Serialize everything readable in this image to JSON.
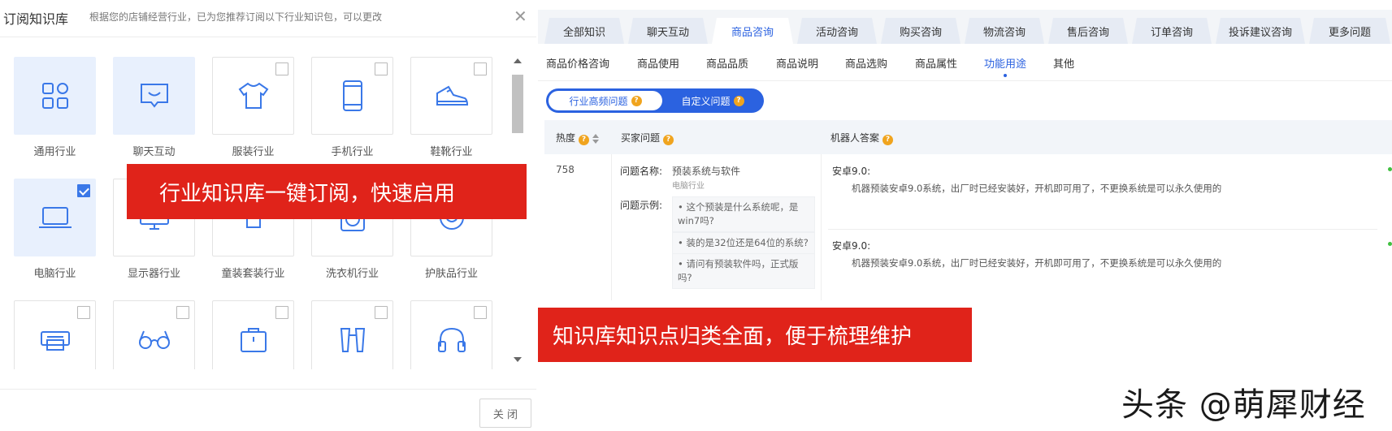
{
  "dialog": {
    "title": "订阅知识库",
    "subtitle": "根据您的店铺经营行业，已为您推荐订阅以下行业知识包，可以更改",
    "close_symbol": "✕",
    "close_button": "关 闭",
    "tiles": [
      {
        "label": "通用行业",
        "icon": "apps-grid-icon",
        "selected": true,
        "checkbox": false
      },
      {
        "label": "聊天互动",
        "icon": "chat-bubble-icon",
        "selected": true,
        "checkbox": false
      },
      {
        "label": "服装行业",
        "icon": "tshirt-icon",
        "selected": false,
        "checkbox": true,
        "checked": false
      },
      {
        "label": "手机行业",
        "icon": "smartphone-icon",
        "selected": false,
        "checkbox": true,
        "checked": false
      },
      {
        "label": "鞋靴行业",
        "icon": "sneaker-icon",
        "selected": false,
        "checkbox": true,
        "checked": false
      },
      {
        "label": "电脑行业",
        "icon": "laptop-icon",
        "selected": true,
        "checkbox": true,
        "checked": true
      },
      {
        "label": "显示器行业",
        "icon": "monitor-icon",
        "selected": false,
        "checkbox": false
      },
      {
        "label": "童装套装行业",
        "icon": "baby-clothes-icon",
        "selected": false,
        "checkbox": false
      },
      {
        "label": "洗衣机行业",
        "icon": "washing-machine-icon",
        "selected": false,
        "checkbox": false
      },
      {
        "label": "护肤品行业",
        "icon": "skincare-icon",
        "selected": false,
        "checkbox": false
      },
      {
        "label": "",
        "icon": "printer-icon",
        "selected": false,
        "checkbox": true,
        "checked": false
      },
      {
        "label": "",
        "icon": "glasses-icon",
        "selected": false,
        "checkbox": true,
        "checked": false
      },
      {
        "label": "",
        "icon": "bag-icon",
        "selected": false,
        "checkbox": true,
        "checked": false
      },
      {
        "label": "",
        "icon": "binoculars-icon",
        "selected": false,
        "checkbox": true,
        "checked": false
      },
      {
        "label": "",
        "icon": "headphones-icon",
        "selected": false,
        "checkbox": true,
        "checked": false
      }
    ]
  },
  "banners": {
    "one": "行业知识库一键订阅，快速启用",
    "two": "知识库知识点归类全面，便于梳理维护"
  },
  "panel": {
    "tabs": [
      "全部知识",
      "聊天互动",
      "商品咨询",
      "活动咨询",
      "购买咨询",
      "物流咨询",
      "售后咨询",
      "订单咨询",
      "投诉建议咨询",
      "更多问题"
    ],
    "active_tab": "商品咨询",
    "subtabs": [
      "商品价格咨询",
      "商品使用",
      "商品品质",
      "商品说明",
      "商品选购",
      "商品属性",
      "功能用途",
      "其他"
    ],
    "active_subtab": "功能用途",
    "toggle": {
      "option1": "行业高频问题",
      "option2": "自定义问题",
      "help": "?"
    },
    "table": {
      "headers": {
        "heat": "热度",
        "question": "买家问题",
        "answer": "机器人答案"
      },
      "row": {
        "heat": "758",
        "name_label": "问题名称:",
        "name": "预装系统与软件",
        "category": "电脑行业",
        "examples_label": "问题示例:",
        "examples": [
          "• 这个预装是什么系统呢，是win7吗?",
          "• 装的是32位还是64位的系统?",
          "• 请问有预装软件吗，正式版吗?"
        ],
        "answers": [
          {
            "title": "安卓9.0:",
            "text": "机器预装安卓9.0系统，出厂时已经安装好，开机即可用了，不更换系统是可以永久使用的"
          },
          {
            "title": "安卓9.0:",
            "text": "机器预装安卓9.0系统，出厂时已经安装好，开机即可用了，不更换系统是可以永久使用的"
          }
        ]
      }
    }
  },
  "watermark": "头条 @萌犀财经",
  "colors": {
    "accent": "#2b62e0",
    "banner": "#e0231a",
    "help": "#f0a41e",
    "selected_tile": "#e8f0fd"
  }
}
